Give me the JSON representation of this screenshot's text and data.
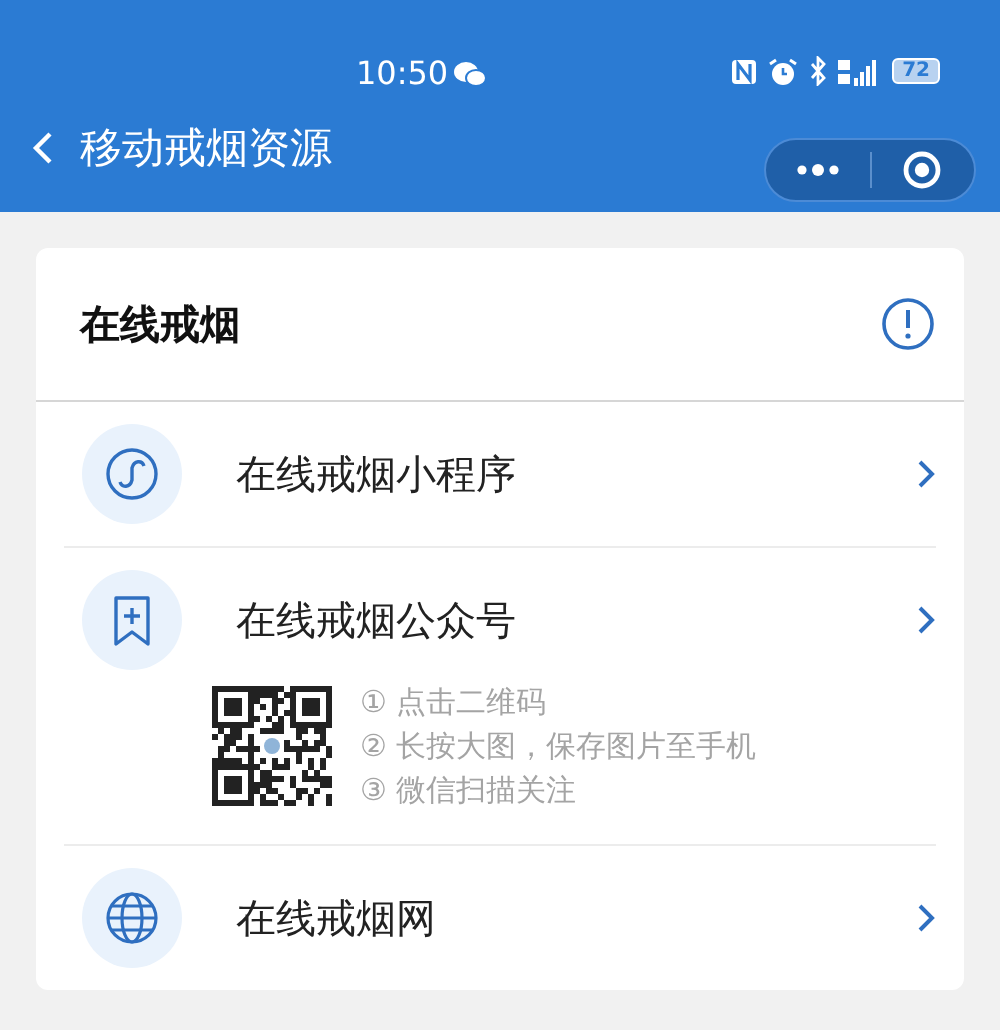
{
  "status_bar": {
    "time": "10:50",
    "battery": "72"
  },
  "nav_bar": {
    "title": "移动戒烟资源"
  },
  "card": {
    "title": "在线戒烟",
    "items": [
      {
        "kind": "link",
        "label": "在线戒烟小程序"
      },
      {
        "kind": "qr",
        "label": "在线戒烟公众号",
        "steps": [
          "① 点击二维码",
          "② 长按大图，保存图片至手机",
          "③ 微信扫描关注"
        ]
      },
      {
        "kind": "link",
        "label": "在线戒烟网"
      }
    ]
  }
}
